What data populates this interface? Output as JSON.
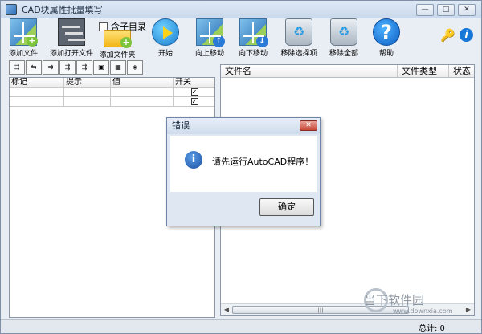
{
  "window": {
    "title": "CAD块属性批量填写",
    "controls": [
      "—",
      "□",
      "✕"
    ]
  },
  "toolbar": {
    "items": [
      {
        "label": "添加文件",
        "icon": "cad-add-file-icon"
      },
      {
        "label": "添加打开文件",
        "icon": "tree-open-icon"
      },
      {
        "label": "添加文件夹",
        "icon": "folder-add-icon"
      },
      {
        "label": "开始",
        "icon": "play-icon"
      },
      {
        "label": "向上移动",
        "icon": "move-up-icon"
      },
      {
        "label": "向下移动",
        "icon": "move-down-icon"
      },
      {
        "label": "移除选择项",
        "icon": "recycle-bin-icon"
      },
      {
        "label": "移除全部",
        "icon": "recycle-bin-all-icon"
      },
      {
        "label": "帮助",
        "icon": "help-icon"
      }
    ],
    "include_subfolder": "含子目录"
  },
  "left_table": {
    "headers": [
      "标记",
      "提示",
      "值",
      "开关"
    ],
    "rows": [
      {
        "mark": "",
        "prompt": "",
        "value": "",
        "switch": "✓"
      },
      {
        "mark": "",
        "prompt": "",
        "value": "",
        "switch": "✓"
      }
    ]
  },
  "file_table": {
    "headers": [
      "文件名",
      "文件类型",
      "状态"
    ]
  },
  "status": {
    "total": "总计: 0"
  },
  "dialog": {
    "title": "错误",
    "message": "请先运行AutoCAD程序！",
    "ok_label": "确定"
  },
  "watermark": {
    "text": "当下软件园",
    "url": "www.downxia.com"
  }
}
